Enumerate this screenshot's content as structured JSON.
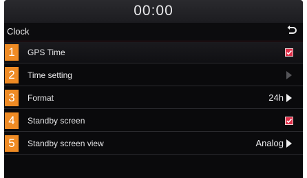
{
  "statusbar": {
    "time": "00:00"
  },
  "header": {
    "title": "Clock",
    "back_icon": "back-return-icon"
  },
  "colors": {
    "accent_orange": "#ef8b24",
    "check_red": "#e0304a",
    "background": "#0a0a0c"
  },
  "menu": {
    "items": [
      {
        "number": "1",
        "label": "GPS Time",
        "control": "checkbox",
        "checked": true
      },
      {
        "number": "2",
        "label": "Time setting",
        "control": "arrow",
        "enabled": false
      },
      {
        "number": "3",
        "label": "Format",
        "value": "24h",
        "control": "arrow",
        "enabled": true
      },
      {
        "number": "4",
        "label": "Standby screen",
        "control": "checkbox",
        "checked": true
      },
      {
        "number": "5",
        "label": "Standby screen view",
        "value": "Analog",
        "control": "arrow",
        "enabled": true
      }
    ]
  }
}
